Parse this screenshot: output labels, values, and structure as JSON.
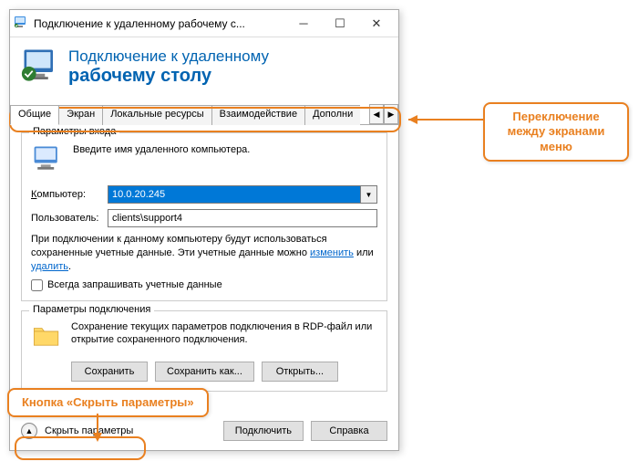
{
  "titlebar": {
    "text": "Подключение к удаленному рабочему с..."
  },
  "header": {
    "line1": "Подключение к удаленному",
    "line2": "рабочему столу"
  },
  "tabs": [
    "Общие",
    "Экран",
    "Локальные ресурсы",
    "Взаимодействие",
    "Дополни"
  ],
  "login": {
    "group_title": "Параметры входа",
    "prompt": "Введите имя удаленного компьютера.",
    "computer_label_pre": "К",
    "computer_label_rest": "омпьютер:",
    "computer_value": "10.0.20.245",
    "user_label": "Пользователь:",
    "user_value": "clients\\support4",
    "info_part1": "При подключении к данному компьютеру будут использоваться сохраненные учетные данные.  Эти учетные данные можно ",
    "info_link1": "изменить",
    "info_mid": " или ",
    "info_link2": "удалить",
    "info_end": ".",
    "checkbox_pre": "В",
    "checkbox_rest": "сегда запрашивать учетные данные"
  },
  "conn": {
    "group_title": "Параметры подключения",
    "text": "Сохранение текущих параметров подключения в RDP-файл или открытие сохраненного подключения.",
    "save": "Сохранить",
    "saveas": "Сохранить как...",
    "open": "Открыть..."
  },
  "footer": {
    "collapse_pre": "Скрыть ",
    "collapse_ul": "п",
    "collapse_rest": "араметры",
    "connect_pre": "П",
    "connect_rest": "одключить",
    "help_pre": "С",
    "help_rest": "правка"
  },
  "annotations": {
    "tabs_switch": "Переключение между экранами меню",
    "hide_btn": "Кнопка «Скрыть параметры»"
  }
}
